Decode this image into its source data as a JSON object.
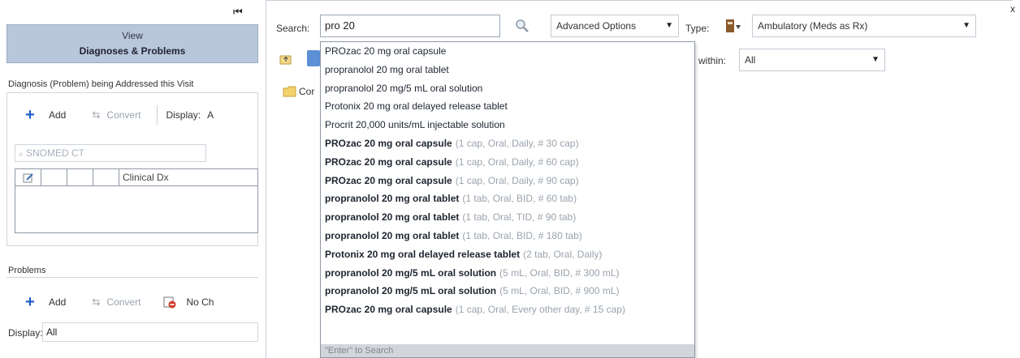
{
  "left_panel": {
    "view_label": "View",
    "view_title": "Diagnoses & Problems",
    "dx_caption": "Diagnosis (Problem) being Addressed this Visit",
    "dx_toolbar": {
      "add": "Add",
      "convert": "Convert",
      "display_label": "Display:",
      "display_value": "A"
    },
    "snomed_placeholder": "SNOMED CT",
    "grid_column": "Clinical Dx",
    "problems_caption": "Problems",
    "problems_toolbar": {
      "add": "Add",
      "convert": "Convert",
      "no_chronic": "No Ch"
    },
    "display_label": "Display:",
    "display_value": "All"
  },
  "search": {
    "label": "Search:",
    "value": "pro 20",
    "advanced_options": "Advanced Options",
    "type_label": "Type:",
    "type_value": "Ambulatory (Meds as Rx)",
    "within_label": "within:",
    "within_value": "All",
    "folder_label": "Cor"
  },
  "suggestions": [
    {
      "drug": "PROzac 20 mg oral capsule",
      "sig": "",
      "bold": false
    },
    {
      "drug": "propranolol 20 mg oral tablet",
      "sig": "",
      "bold": false
    },
    {
      "drug": "propranolol 20 mg/5 mL oral solution",
      "sig": "",
      "bold": false
    },
    {
      "drug": "Protonix 20 mg oral delayed release tablet",
      "sig": "",
      "bold": false
    },
    {
      "drug": "Procrit 20,000 units/mL injectable solution",
      "sig": "",
      "bold": false
    },
    {
      "drug": "PROzac 20 mg oral capsule",
      "sig": "(1 cap, Oral, Daily, # 30 cap)",
      "bold": true
    },
    {
      "drug": "PROzac 20 mg oral capsule",
      "sig": "(1 cap, Oral, Daily, # 60 cap)",
      "bold": true
    },
    {
      "drug": "PROzac 20 mg oral capsule",
      "sig": "(1 cap, Oral, Daily, # 90 cap)",
      "bold": true
    },
    {
      "drug": "propranolol 20 mg oral tablet",
      "sig": "(1 tab, Oral, BID, # 60 tab)",
      "bold": true
    },
    {
      "drug": "propranolol 20 mg oral tablet",
      "sig": "(1 tab, Oral, TID, # 90 tab)",
      "bold": true
    },
    {
      "drug": "propranolol 20 mg oral tablet",
      "sig": "(1 tab, Oral, BID, # 180 tab)",
      "bold": true
    },
    {
      "drug": "Protonix 20 mg oral delayed release tablet",
      "sig": "(2 tab, Oral, Daily)",
      "bold": true
    },
    {
      "drug": "propranolol 20 mg/5 mL oral solution",
      "sig": "(5 mL, Oral, BID, # 300 mL)",
      "bold": true
    },
    {
      "drug": "propranolol 20 mg/5 mL oral solution",
      "sig": "(5 mL, Oral, BID, # 900 mL)",
      "bold": true
    },
    {
      "drug": "PROzac 20 mg oral capsule",
      "sig": "(1 cap, Oral, Every other day, # 15 cap)",
      "bold": true
    }
  ],
  "enter_hint": "\"Enter\" to Search",
  "icons": {
    "collapse": "collapse-left-icon",
    "search": "magnifier-icon",
    "type": "prescription-icon",
    "close": "close-icon",
    "folder": "folder-icon"
  },
  "colors": {
    "view_header": "#b8c7db",
    "add_plus": "#1f5fc6",
    "hint_bar": "#d2d5da"
  }
}
